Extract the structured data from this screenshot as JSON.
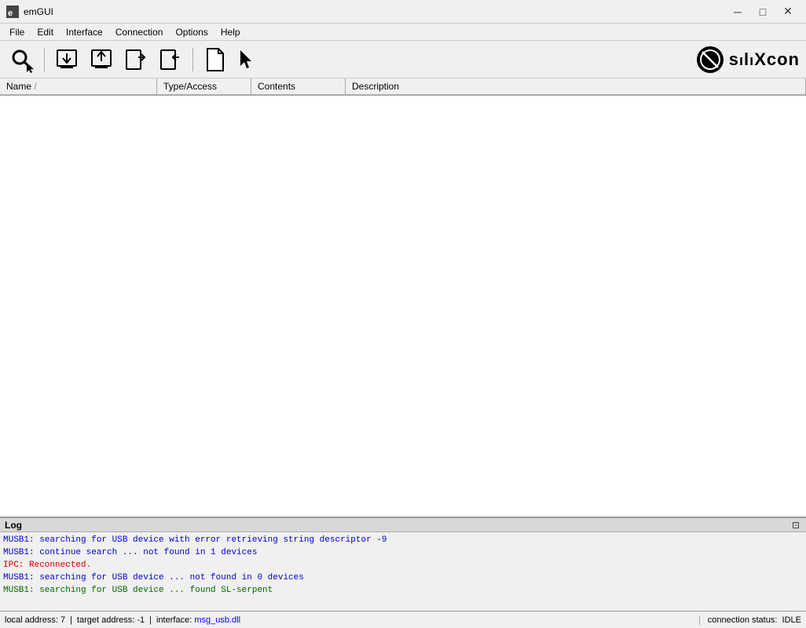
{
  "titleBar": {
    "appIcon": "em-icon",
    "title": "emGUI",
    "controls": {
      "minimize": "─",
      "maximize": "□",
      "close": "✕"
    }
  },
  "menuBar": {
    "items": [
      {
        "id": "file",
        "label": "File"
      },
      {
        "id": "edit",
        "label": "Edit"
      },
      {
        "id": "interface",
        "label": "Interface"
      },
      {
        "id": "connection",
        "label": "Connection"
      },
      {
        "id": "options",
        "label": "Options"
      },
      {
        "id": "help",
        "label": "Help"
      }
    ]
  },
  "toolbar": {
    "buttons": [
      {
        "id": "search",
        "icon": "search-icon",
        "tooltip": "Search"
      },
      {
        "id": "download",
        "icon": "download-icon",
        "tooltip": "Download"
      },
      {
        "id": "upload",
        "icon": "upload-icon",
        "tooltip": "Upload"
      },
      {
        "id": "export",
        "icon": "export-icon",
        "tooltip": "Export"
      },
      {
        "id": "import",
        "icon": "import-icon",
        "tooltip": "Import"
      },
      {
        "id": "new-doc",
        "icon": "new-doc-icon",
        "tooltip": "New Document"
      },
      {
        "id": "cursor",
        "icon": "cursor-icon",
        "tooltip": "Cursor"
      }
    ],
    "logo": {
      "text": "sılıXcon"
    }
  },
  "tableHeaders": [
    {
      "id": "name",
      "label": "Name",
      "sortIndicator": "/"
    },
    {
      "id": "type",
      "label": "Type/Access"
    },
    {
      "id": "contents",
      "label": "Contents"
    },
    {
      "id": "description",
      "label": "Description"
    }
  ],
  "log": {
    "title": "Log",
    "lines": [
      {
        "text": "MUSB1: searching for USB device with error retrieving string descriptor -9",
        "color": "blue"
      },
      {
        "text": "MUSB1: continue search ... not found in 1 devices",
        "color": "blue"
      },
      {
        "text": "IPC: Reconnected.",
        "color": "red"
      },
      {
        "text": "MUSB1: searching for USB device ... not found in 0 devices",
        "color": "blue"
      },
      {
        "text": "MUSB1: searching for USB device ... found SL-serpent",
        "color": "green"
      }
    ]
  },
  "statusBar": {
    "localAddress": {
      "label": "local address:",
      "value": "7"
    },
    "targetAddress": {
      "label": "target address:",
      "value": "-1"
    },
    "interface": {
      "label": "interface:",
      "value": "msg_usb.dll"
    },
    "connectionStatus": {
      "label": "connection status:",
      "value": "IDLE"
    }
  }
}
